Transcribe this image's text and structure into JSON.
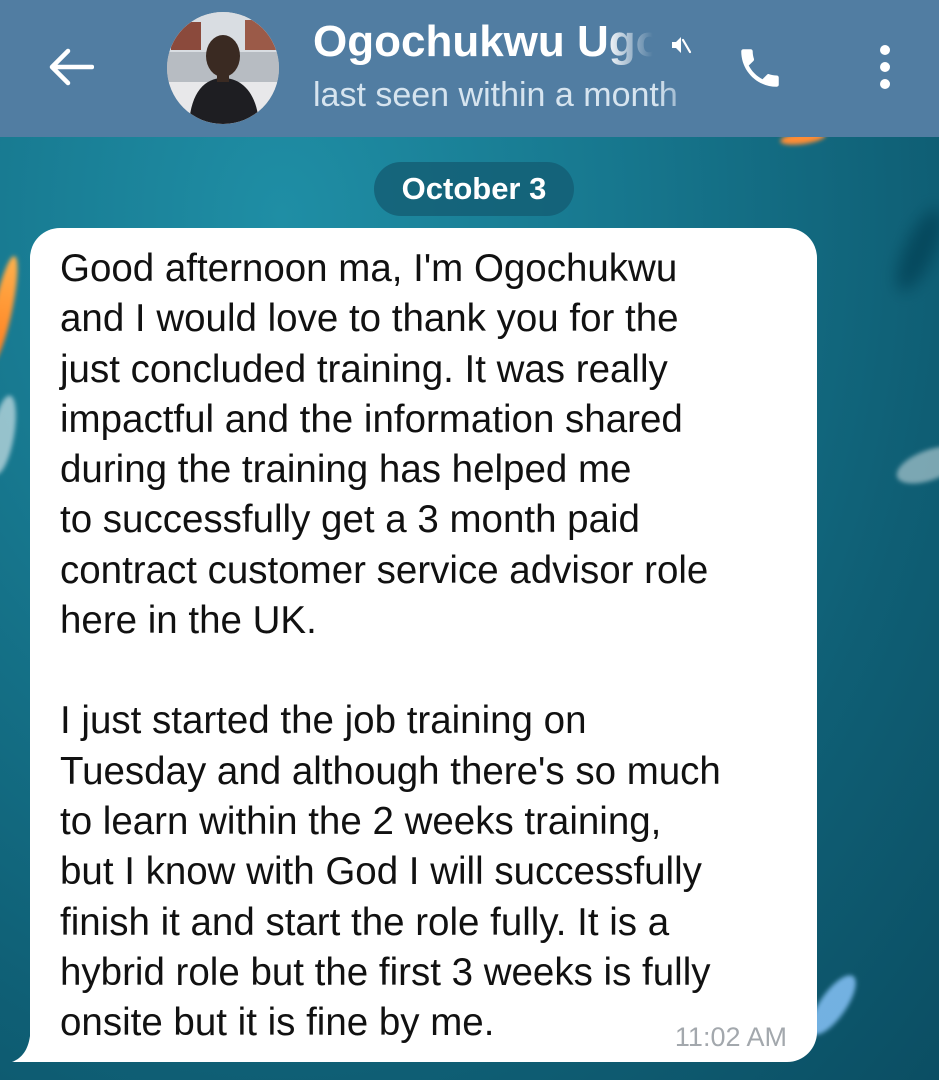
{
  "header": {
    "contact_name": "Ogochukwu Ugo",
    "status": "last seen within a month",
    "back_icon": "arrow-left-icon",
    "mute_icon": "muted-speaker-icon",
    "call_icon": "phone-icon",
    "menu_icon": "more-vertical-icon",
    "background_color": "#517da2"
  },
  "chat": {
    "date_label": "October 3",
    "message": {
      "paragraphs": [
        "Good afternoon ma, I'm Ogochukwu\nand I would love to thank you for the\njust concluded training. It was really\nimpactful and the information shared\nduring the training has helped me\nto successfully get a 3 month paid\ncontract customer service advisor role\nhere in the UK.",
        "I just started the job training on\nTuesday and although there's so much\nto learn within the 2 weeks training,\nbut I know with God I will successfully\nfinish it and start the role fully. It is a\nhybrid role but the first 3 weeks is fully\nonsite but it is fine by me."
      ],
      "time": "11:02 AM"
    }
  }
}
